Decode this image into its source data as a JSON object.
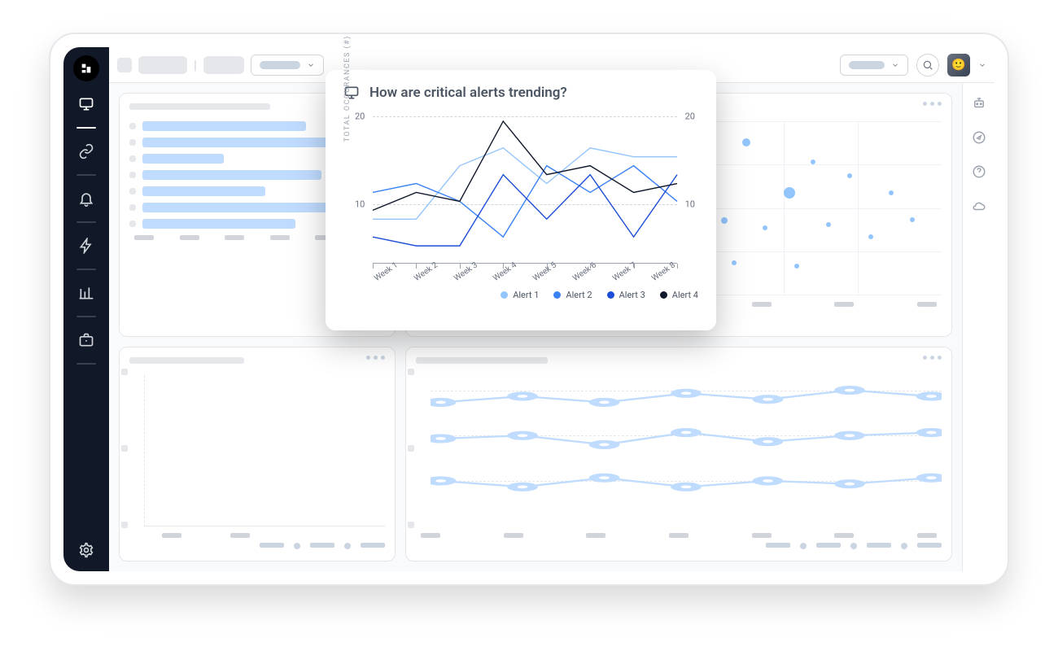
{
  "popup": {
    "title": "How are critical alerts trending?",
    "y_axis_label": "TOTAL OCCURANCES (#)",
    "y_ticks": [
      10,
      20
    ],
    "legend": [
      "Alert 1",
      "Alert 2",
      "Alert 3",
      "Alert 4"
    ],
    "colors": [
      "#93c5fd",
      "#3b82f6",
      "#1d4ed8",
      "#0f172a"
    ]
  },
  "chart_data": {
    "type": "line",
    "title": "How are critical alerts trending?",
    "xlabel": "",
    "ylabel": "TOTAL OCCURANCES (#)",
    "ylim": [
      3,
      20
    ],
    "categories": [
      "Week 1",
      "Week 2",
      "Week 3",
      "Week 4",
      "Week 5",
      "Week 6",
      "Week 7",
      "Week 8"
    ],
    "series": [
      {
        "name": "Alert 1",
        "color": "#93c5fd",
        "values": [
          8,
          8,
          14,
          16,
          12,
          16,
          15,
          15
        ]
      },
      {
        "name": "Alert 2",
        "color": "#3b82f6",
        "values": [
          11,
          12,
          10,
          6,
          14,
          11,
          14,
          10
        ]
      },
      {
        "name": "Alert 3",
        "color": "#1d4ed8",
        "values": [
          6,
          5,
          5,
          13,
          8,
          13,
          6,
          13
        ]
      },
      {
        "name": "Alert 4",
        "color": "#0f172a",
        "values": [
          9,
          11,
          10,
          19,
          13,
          14,
          11,
          12
        ]
      }
    ],
    "legend_position": "bottom-right",
    "grid": "dashed-horizontal"
  }
}
